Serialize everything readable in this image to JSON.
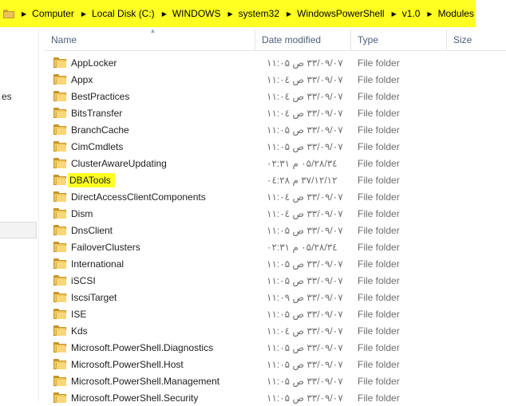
{
  "address_bar": {
    "highlight_color": "#ffff22",
    "segments": [
      "Computer",
      "Local Disk (C:)",
      "WINDOWS",
      "system32",
      "WindowsPowerShell",
      "v1.0",
      "Modules"
    ]
  },
  "nav_pane": {
    "fragment_text": "es"
  },
  "columns": {
    "name": "Name",
    "date": "Date modified",
    "type": "Type",
    "size": "Size"
  },
  "files": [
    {
      "name": "AppLocker",
      "date": "۳۳/۰۹/۰۷ ص ۱۱:۰۵",
      "type": "File folder"
    },
    {
      "name": "Appx",
      "date": "۳۳/۰۹/۰۷ ص ۱۱:۰٤",
      "type": "File folder"
    },
    {
      "name": "BestPractices",
      "date": "۳۳/۰۹/۰۷ ص ۱۱:۰٤",
      "type": "File folder"
    },
    {
      "name": "BitsTransfer",
      "date": "۳۳/۰۹/۰۷ ص ۱۱:۰٤",
      "type": "File folder"
    },
    {
      "name": "BranchCache",
      "date": "۳۳/۰۹/۰۷ ص ۱۱:۰۵",
      "type": "File folder"
    },
    {
      "name": "CimCmdlets",
      "date": "۳۳/۰۹/۰۷ ص ۱۱:۰۵",
      "type": "File folder"
    },
    {
      "name": "ClusterAwareUpdating",
      "date": "۳٤/۰۵/۲۸ م ۰۲:۳۱",
      "type": "File folder"
    },
    {
      "name": "DBATools",
      "date": "۳۷/۱۲/۱۲ م ۰٤:۲۸",
      "type": "File folder",
      "highlighted": true
    },
    {
      "name": "DirectAccessClientComponents",
      "date": "۳۳/۰۹/۰۷ ص ۱۱:۰٤",
      "type": "File folder"
    },
    {
      "name": "Dism",
      "date": "۳۳/۰۹/۰۷ ص ۱۱:۰٤",
      "type": "File folder"
    },
    {
      "name": "DnsClient",
      "date": "۳۳/۰۹/۰۷ ص ۱۱:۰۵",
      "type": "File folder"
    },
    {
      "name": "FailoverClusters",
      "date": "۳٤/۰۵/۲۸ م ۰۲:۳۱",
      "type": "File folder"
    },
    {
      "name": "International",
      "date": "۳۳/۰۹/۰۷ ص ۱۱:۰۵",
      "type": "File folder"
    },
    {
      "name": "iSCSI",
      "date": "۳۳/۰۹/۰۷ ص ۱۱:۰۵",
      "type": "File folder"
    },
    {
      "name": "IscsiTarget",
      "date": "۳۳/۰۹/۰۷ ص ۱۱:۰۹",
      "type": "File folder"
    },
    {
      "name": "ISE",
      "date": "۳۳/۰۹/۰۷ ص ۱۱:۰۵",
      "type": "File folder"
    },
    {
      "name": "Kds",
      "date": "۳۳/۰۹/۰۷ ص ۱۱:۰٤",
      "type": "File folder"
    },
    {
      "name": "Microsoft.PowerShell.Diagnostics",
      "date": "۳۳/۰۹/۰۷ ص ۱۱:۰۵",
      "type": "File folder"
    },
    {
      "name": "Microsoft.PowerShell.Host",
      "date": "۳۳/۰۹/۰۷ ص ۱۱:۰۵",
      "type": "File folder"
    },
    {
      "name": "Microsoft.PowerShell.Management",
      "date": "۳۳/۰۹/۰۷ ص ۱۱:۰۵",
      "type": "File folder"
    },
    {
      "name": "Microsoft.PowerShell.Security",
      "date": "۳۳/۰۹/۰۷ ص ۱۱:۰۵",
      "type": "File folder"
    }
  ]
}
